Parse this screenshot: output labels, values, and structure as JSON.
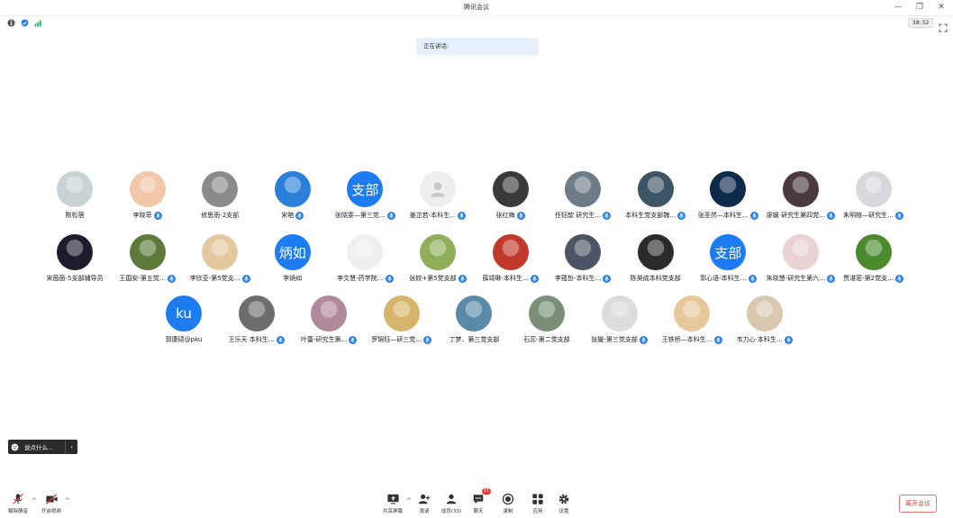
{
  "window": {
    "title": "腾讯会议"
  },
  "status": {
    "timer": "38:32"
  },
  "speaking_label": "正在讲话:",
  "chat": {
    "placeholder": "说点什么..."
  },
  "rows": [
    [
      {
        "name": "陈松蓓",
        "avatar": "photo",
        "color": "#c9d3d6",
        "mic": false
      },
      {
        "name": "李晓菲",
        "avatar": "photo",
        "color": "#f3c6a8",
        "mic": true
      },
      {
        "name": "修思雨-2支部",
        "avatar": "photo",
        "color": "#8a8a8a",
        "mic": false
      },
      {
        "name": "宋艳",
        "avatar": "photo",
        "color": "#2a7fd9",
        "mic": true
      },
      {
        "name": "张晓雯—第三党…",
        "avatar": "text",
        "text": "支部",
        "mic": true
      },
      {
        "name": "姜芷若-本科生…",
        "avatar": "gray",
        "mic": true
      },
      {
        "name": "张红梅",
        "avatar": "photo",
        "color": "#3a3a3a",
        "mic": true
      },
      {
        "name": "任钰歆 研究生…",
        "avatar": "photo",
        "color": "#6f7c88",
        "mic": true
      },
      {
        "name": "本科生党支部魏…",
        "avatar": "photo",
        "color": "#3e5566",
        "mic": true
      },
      {
        "name": "张圣然—本科生…",
        "avatar": "photo",
        "color": "#0d2a4a",
        "mic": true
      },
      {
        "name": "廖媛 研究生第四党…",
        "avatar": "photo",
        "color": "#4a3a3e",
        "mic": true
      },
      {
        "name": "朱明楦—研究生…",
        "avatar": "photo",
        "color": "#d8d8dc",
        "mic": true
      }
    ],
    [
      {
        "name": "宋茵茵-5支部辅导员",
        "avatar": "photo",
        "color": "#1c1c2e",
        "mic": false
      },
      {
        "name": "王国安-第五党…",
        "avatar": "photo",
        "color": "#5d7a3a",
        "mic": true
      },
      {
        "name": "李欣亚-第5党支…",
        "avatar": "photo",
        "color": "#e4c9a0",
        "mic": true
      },
      {
        "name": "李炳如",
        "avatar": "text",
        "text": "炳如",
        "mic": false
      },
      {
        "name": "李文慧-药学院…",
        "avatar": "photo",
        "color": "#efefef",
        "mic": true
      },
      {
        "name": "张姣+第5党支部",
        "avatar": "photo",
        "color": "#8fae5a",
        "mic": true
      },
      {
        "name": "薛靖琳-本科生…",
        "avatar": "photo",
        "color": "#c0392b",
        "mic": true
      },
      {
        "name": "李蕴哲-本科生…",
        "avatar": "photo",
        "color": "#4b5563",
        "mic": true
      },
      {
        "name": "陈昊成本科党支部",
        "avatar": "photo",
        "color": "#2b2b2b",
        "mic": false
      },
      {
        "name": "郭心语-本科生…",
        "avatar": "text",
        "text": "支部",
        "mic": true
      },
      {
        "name": "朱晓慧-研究生第六…",
        "avatar": "photo",
        "color": "#e8d2d2",
        "mic": true
      },
      {
        "name": "贾湛密-第2党支…",
        "avatar": "photo",
        "color": "#4c8a2e",
        "mic": true
      }
    ],
    [
      {
        "name": "郭康硕@pku",
        "avatar": "text",
        "text": "ku",
        "mic": false
      },
      {
        "name": "王乐天 本科生…",
        "avatar": "photo",
        "color": "#6d6d6d",
        "mic": true
      },
      {
        "name": "叶蕾-研究生第…",
        "avatar": "photo",
        "color": "#b0899a",
        "mic": true
      },
      {
        "name": "罗锦钰—研三党…",
        "avatar": "photo",
        "color": "#d6b56a",
        "mic": true
      },
      {
        "name": "丁梦、第三党支部",
        "avatar": "photo",
        "color": "#5a8aa8",
        "mic": false
      },
      {
        "name": "石蕊-第二党支部",
        "avatar": "photo",
        "color": "#7a8f7a",
        "mic": false
      },
      {
        "name": "张媛-第三党支部",
        "avatar": "photo",
        "color": "#dcdcdc",
        "mic": true
      },
      {
        "name": "王铁桥—本科生…",
        "avatar": "photo",
        "color": "#e6c89a",
        "mic": true
      },
      {
        "name": "韦力心·本科生…",
        "avatar": "photo",
        "color": "#d9c9b0",
        "mic": true
      }
    ]
  ],
  "toolbar": {
    "left": [
      {
        "label": "解除静音",
        "icon": "mic-muted-icon"
      },
      {
        "label": "开启视频",
        "icon": "video-off-icon"
      }
    ],
    "center": [
      {
        "label": "共享屏幕",
        "icon": "share-screen-icon"
      },
      {
        "label": "邀请",
        "icon": "invite-icon"
      },
      {
        "label": "成员(33)",
        "icon": "members-icon"
      },
      {
        "label": "聊天",
        "icon": "chat-icon",
        "badge": "21"
      },
      {
        "label": "录制",
        "icon": "record-icon"
      },
      {
        "label": "应用",
        "icon": "apps-icon"
      },
      {
        "label": "设置",
        "icon": "settings-icon"
      }
    ],
    "leave_label": "离开会议"
  },
  "colors": {
    "accent": "#1d7cf2",
    "leave": "#e53935"
  }
}
